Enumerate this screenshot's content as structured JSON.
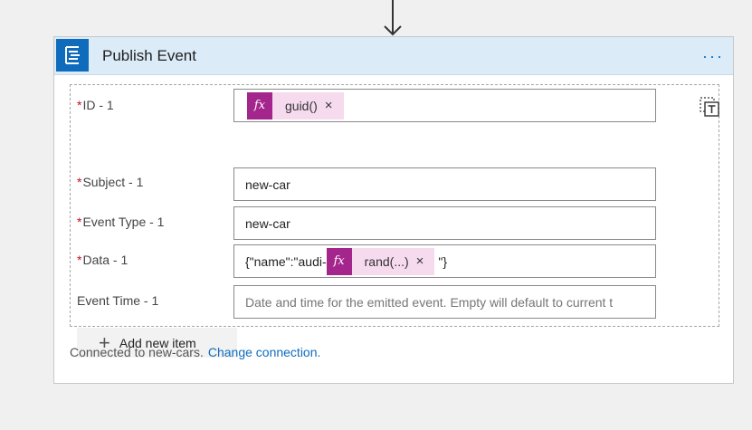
{
  "action": {
    "title": "Publish Event",
    "menu": "···"
  },
  "fields": [
    {
      "label": "ID - 1",
      "required": "*",
      "token": {
        "fx": "fx",
        "name": "guid()",
        "close": "×"
      }
    },
    {
      "label": "Subject - 1",
      "required": "*",
      "value": "new-car"
    },
    {
      "label": "Event Type - 1",
      "required": "*",
      "value": "new-car"
    },
    {
      "label": "Data - 1",
      "required": "*",
      "prefix": "{\"name\":\"audi-",
      "token": {
        "fx": "fx",
        "name": "rand(...)",
        "close": "×"
      },
      "suffix": "\"}"
    },
    {
      "label": "Event Time - 1",
      "placeholder": "Date and time for the emitted event. Empty will default to current t"
    }
  ],
  "add_item_label": "Add new item",
  "connection": {
    "text": "Connected to new-cars.",
    "link": "Change connection."
  },
  "colors": {
    "header_bg": "#dcebf8",
    "icon_bg": "#0f6cbd",
    "token_fx": "#a4268d",
    "token_bg": "#f6dbee",
    "link": "#0f6cbd",
    "required": "#c50f1f"
  }
}
